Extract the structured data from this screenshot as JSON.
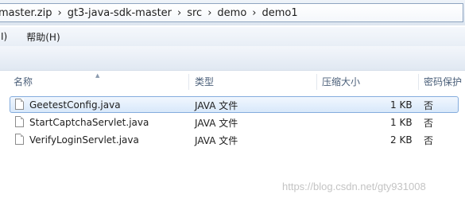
{
  "address": {
    "crumbs": [
      "master.zip",
      "gt3-java-sdk-master",
      "src",
      "demo",
      "demo1"
    ],
    "separator": "›"
  },
  "menu": {
    "partial_label": "I)",
    "help_label": "帮助(H)"
  },
  "columns": {
    "name": "名称",
    "type": "类型",
    "compressed_size": "压缩大小",
    "password": "密码保护"
  },
  "files": [
    {
      "name": "GeetestConfig.java",
      "type": "JAVA 文件",
      "size": "1 KB",
      "password": "否",
      "selected": true
    },
    {
      "name": "StartCaptchaServlet.java",
      "type": "JAVA 文件",
      "size": "1 KB",
      "password": "否",
      "selected": false
    },
    {
      "name": "VerifyLoginServlet.java",
      "type": "JAVA 文件",
      "size": "2 KB",
      "password": "否",
      "selected": false
    }
  ],
  "watermark": "https://blog.csdn.net/gty931008"
}
